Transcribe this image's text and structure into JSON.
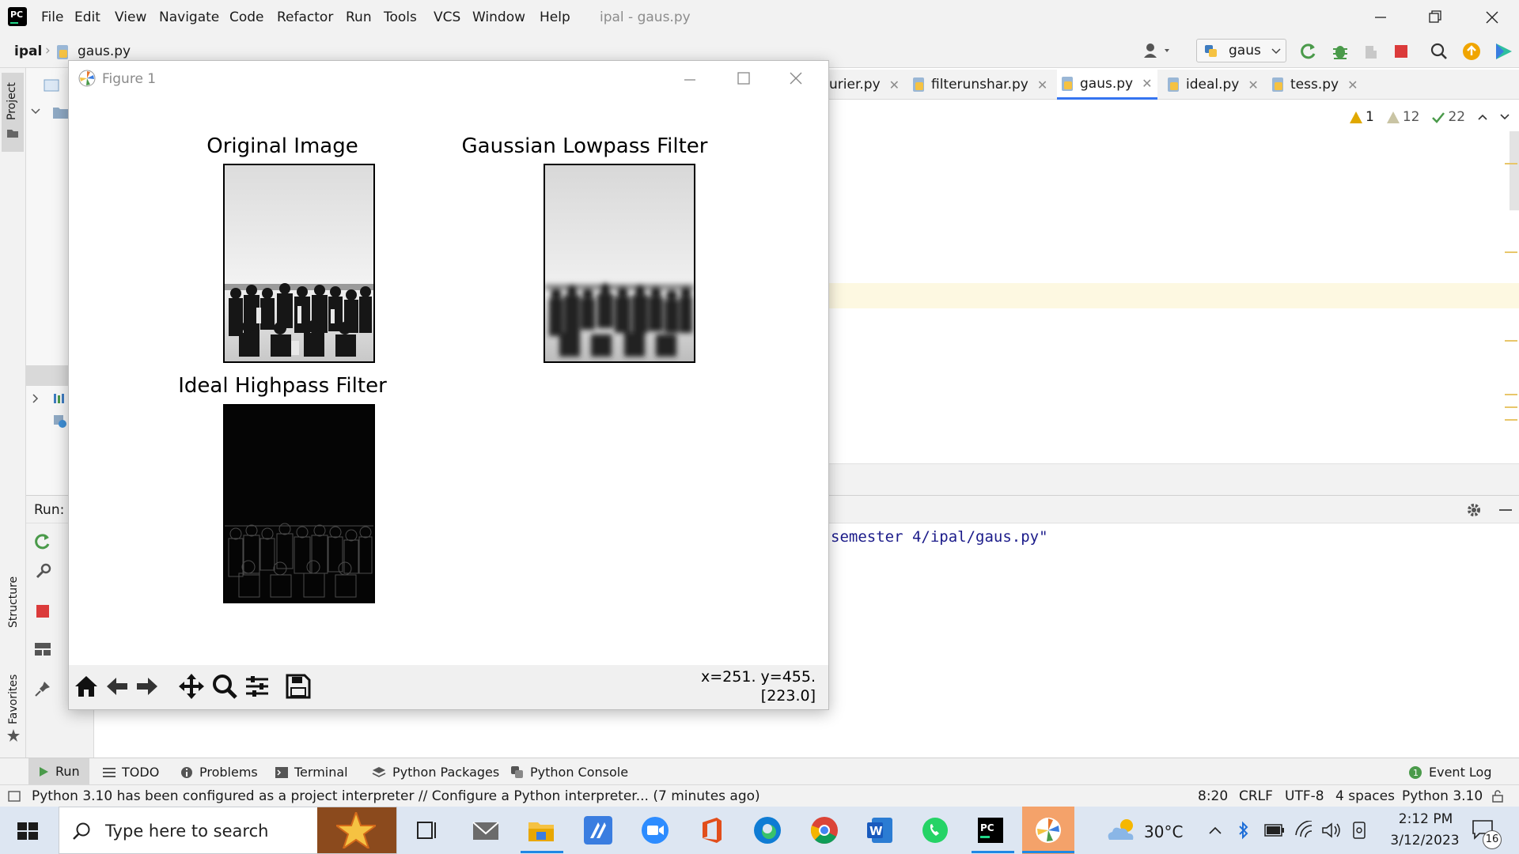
{
  "ide": {
    "menu": [
      "File",
      "Edit",
      "View",
      "Navigate",
      "Code",
      "Refactor",
      "Run",
      "Tools",
      "VCS",
      "Window",
      "Help"
    ],
    "window_title": "ipal - gaus.py",
    "breadcrumb": {
      "project": "ipal",
      "file": "gaus.py"
    },
    "run_config": "gaus",
    "tabs": [
      {
        "label": "urier.py"
      },
      {
        "label": "filterunshar.py"
      },
      {
        "label": "gaus.py",
        "active": true
      },
      {
        "label": "ideal.py"
      },
      {
        "label": "tess.py"
      }
    ],
    "inspections": {
      "warnings": "1",
      "weak_warnings": "12",
      "typos": "22"
    },
    "left_strip": {
      "project": "Project",
      "structure": "Structure",
      "favorites": "Favorites"
    },
    "run_label": "Run:",
    "console_line": "semester 4/ipal/gaus.py\"",
    "bottom_tools": [
      "Run",
      "TODO",
      "Problems",
      "Terminal",
      "Python Packages",
      "Python Console"
    ],
    "event_log": "Event Log",
    "status": {
      "message": "Python 3.10 has been configured as a project interpreter // Configure a Python interpreter... (7 minutes ago)",
      "position": "8:20",
      "line_sep": "CRLF",
      "encoding": "UTF-8",
      "indent": "4 spaces",
      "interpreter": "Python 3.10"
    },
    "colors": {
      "accent": "#3574f0",
      "warning": "#e0a800",
      "ok": "#4a9a4a"
    }
  },
  "figure": {
    "title": "Figure 1",
    "plots": [
      {
        "title": "Original Image",
        "kind": "grayscale-photo"
      },
      {
        "title": "Gaussian Lowpass Filter",
        "kind": "blurred-photo"
      },
      {
        "title": "Ideal Highpass Filter",
        "kind": "edge-map"
      }
    ],
    "coords_line1": "x=251. y=455.",
    "coords_line2": "[223.0]",
    "toolbar_icons": [
      "home-icon",
      "back-icon",
      "forward-icon",
      "pan-icon",
      "zoom-icon",
      "configure-icon",
      "save-icon"
    ]
  },
  "taskbar": {
    "search_placeholder": "Type here to search",
    "weather": "30°C",
    "time": "2:12 PM",
    "date": "3/12/2023",
    "notifications": "16"
  }
}
